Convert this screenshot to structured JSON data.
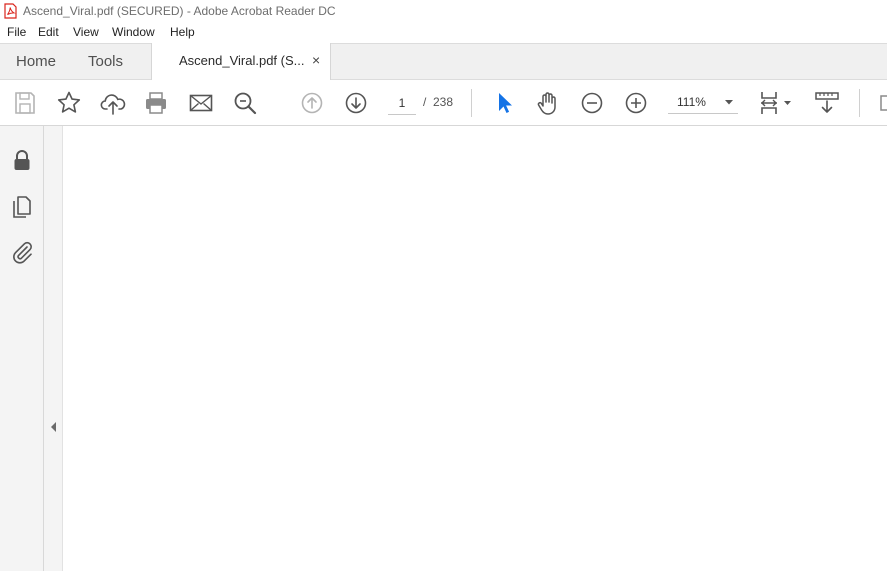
{
  "window": {
    "title": "Ascend_Viral.pdf (SECURED) - Adobe Acrobat Reader DC"
  },
  "menu": {
    "file": "File",
    "edit": "Edit",
    "view": "View",
    "window": "Window",
    "help": "Help"
  },
  "tabs": {
    "home": "Home",
    "tools": "Tools",
    "document": "Ascend_Viral.pdf (SECURED)",
    "close_glyph": "×"
  },
  "toolbar": {
    "page_current": "1",
    "page_separator": "/",
    "page_total": "238",
    "zoom": "111%",
    "icons": [
      "save-icon",
      "bookmark-star-icon",
      "upload-cloud-icon",
      "print-icon",
      "email-icon",
      "find-zoom-icon",
      "prev-page-icon",
      "next-page-icon",
      "select-cursor-icon",
      "hand-icon",
      "zoom-out-icon",
      "zoom-in-icon",
      "page-fit-icon",
      "scroll-mode-icon"
    ],
    "active_tool_color": "#1473e6"
  },
  "left_panel": {
    "icons": [
      "security-lock-icon",
      "pages-icon",
      "attachments-icon"
    ]
  },
  "colors": {
    "accent": "#1473e6",
    "pdf_red": "#d9241c"
  }
}
